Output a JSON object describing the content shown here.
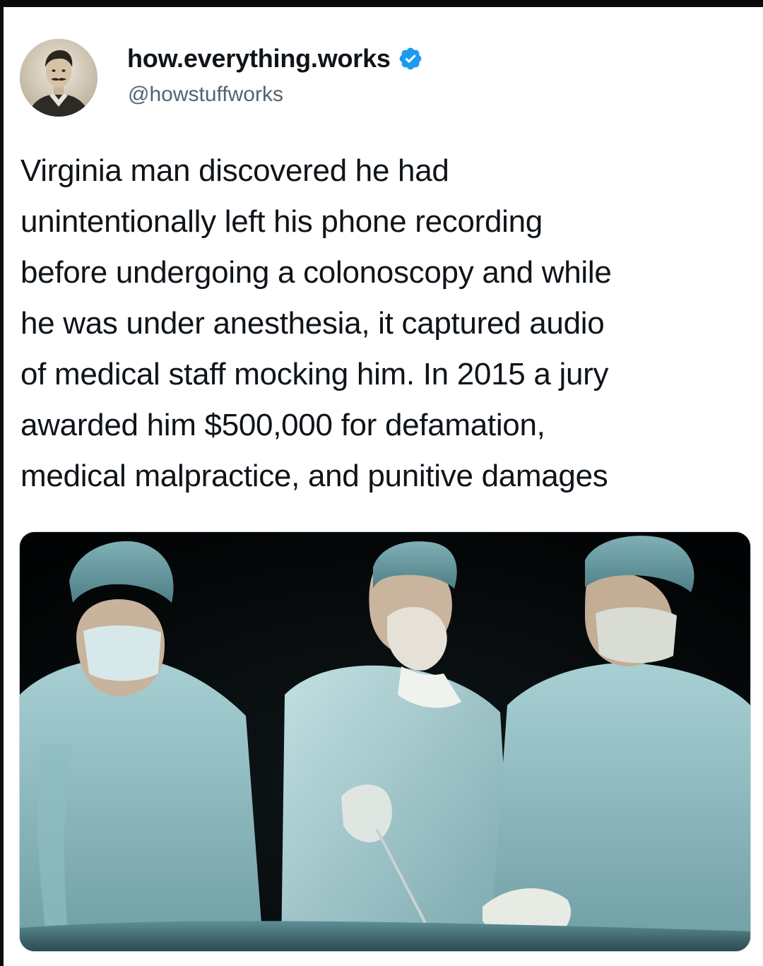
{
  "tweet": {
    "author": {
      "display_name": "how.everything.works",
      "handle": "@howstuffworks",
      "verified": true,
      "verified_icon": "verified-badge-icon",
      "avatar": "vintage-portrait-avatar"
    },
    "text_lines": [
      "Virginia man discovered he had",
      "unintentionally left his phone recording",
      "before undergoing a colonoscopy and while",
      "he was under anesthesia, it captured audio",
      "of medical staff mocking him. In 2015 a jury",
      "awarded him $500,000 for defamation,",
      "medical malpractice, and punitive damages"
    ],
    "media": {
      "type": "photo",
      "subject": "three surgeons in scrubs and masks in a dark operating room"
    }
  },
  "colors": {
    "background": "#ffffff",
    "frame": "#0b0b0e",
    "text_primary": "#0f1419",
    "text_secondary": "#536471",
    "verified": "#1d9bf0",
    "scrubs": "#9cc3c9"
  }
}
